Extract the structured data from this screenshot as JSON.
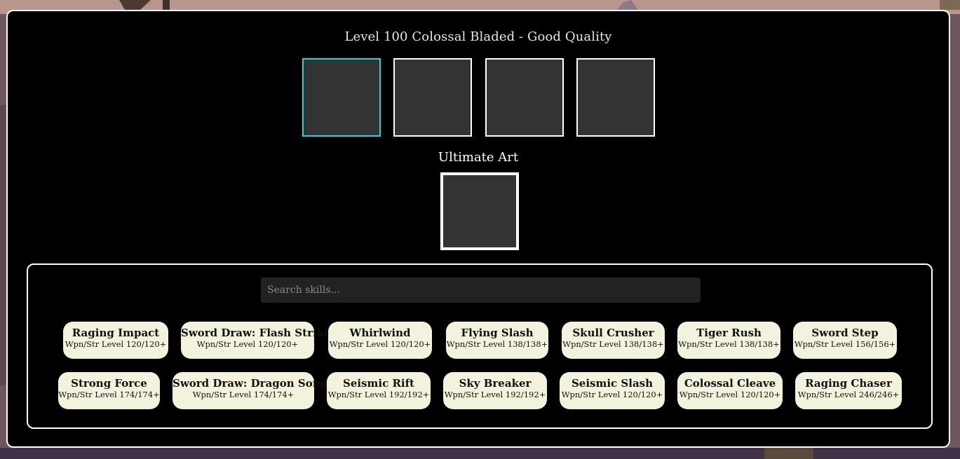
{
  "header": {
    "title": "Level 100 Colossal Bladed - Good Quality"
  },
  "skill_slots": {
    "selected_index": 0,
    "count": 4
  },
  "ultimate": {
    "label": "Ultimate Art"
  },
  "search": {
    "placeholder": "Search skills...",
    "value": ""
  },
  "colors": {
    "selected_slot_border": "#1ed6e0",
    "slot_fill": "#333333",
    "chip_background": "#f3f2dc",
    "panel_background": "#000000"
  },
  "skills": [
    {
      "name": "Raging Impact",
      "requirement": "Wpn/Str Level 120/120+"
    },
    {
      "name": "Sword Draw: Flash Strike",
      "requirement": "Wpn/Str Level 120/120+"
    },
    {
      "name": "Whirlwind",
      "requirement": "Wpn/Str Level 120/120+"
    },
    {
      "name": "Flying Slash",
      "requirement": "Wpn/Str Level 138/138+"
    },
    {
      "name": "Skull Crusher",
      "requirement": "Wpn/Str Level 138/138+"
    },
    {
      "name": "Tiger Rush",
      "requirement": "Wpn/Str Level 138/138+"
    },
    {
      "name": "Sword Step",
      "requirement": "Wpn/Str Level 156/156+"
    },
    {
      "name": "Strong Force",
      "requirement": "Wpn/Str Level 174/174+"
    },
    {
      "name": "Sword Draw: Dragon Song",
      "requirement": "Wpn/Str Level 174/174+"
    },
    {
      "name": "Seismic Rift",
      "requirement": "Wpn/Str Level 192/192+"
    },
    {
      "name": "Sky Breaker",
      "requirement": "Wpn/Str Level 192/192+"
    },
    {
      "name": "Seismic Slash",
      "requirement": "Wpn/Str Level 120/120+"
    },
    {
      "name": "Colossal Cleave",
      "requirement": "Wpn/Str Level 120/120+"
    },
    {
      "name": "Raging Chaser",
      "requirement": "Wpn/Str Level 246/246+"
    }
  ]
}
